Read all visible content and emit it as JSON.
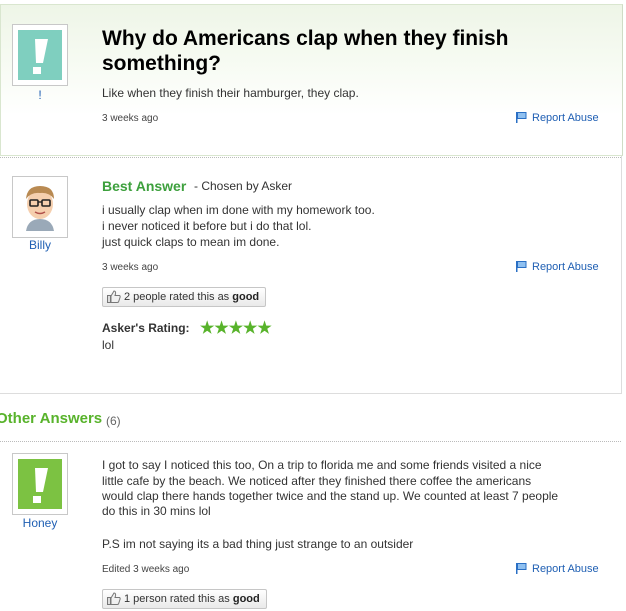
{
  "question": {
    "asker_name": "!",
    "title": "Why do Americans clap when they finish something?",
    "body": "Like when they finish their hamburger, they clap.",
    "time": "3 weeks ago",
    "report_label": "Report Abuse"
  },
  "best_answer": {
    "label": "Best Answer",
    "chosen_text": "- Chosen by Asker",
    "author": "Billy",
    "lines": [
      "i usually clap when im done with my homework too.",
      "i never noticed it before but i do that lol.",
      "just quick claps to mean im done."
    ],
    "time": "3 weeks ago",
    "report_label": "Report Abuse",
    "rating_text": "2 people rated this as",
    "rating_word": "good",
    "asker_rating_label": "Asker's Rating:",
    "asker_rating_stars": 5,
    "asker_rating_display": "★★★★★",
    "asker_comment": "lol"
  },
  "other_answers": {
    "title": "Other Answers",
    "count": "(6)",
    "items": [
      {
        "author": "Honey",
        "lines": [
          "I got to say I noticed this too, On a trip to florida me and some friends visited a nice",
          "little cafe by the beach. We noticed after they finished there coffee the americans",
          "would clap there hands together twice and the stand up. We counted at least 7 people",
          "do this in 30 mins lol"
        ],
        "ps": "P.S im not saying its a bad thing just strange to an outsider",
        "time": "Edited 3 weeks ago",
        "report_label": "Report Abuse",
        "rating_text": "1 person rated this as",
        "rating_word": "good"
      }
    ]
  },
  "colors": {
    "accent_green": "#58b32b",
    "link_blue": "#1f5fb3",
    "logo_teal": "#7fcfbf",
    "logo_green": "#7cc242"
  }
}
